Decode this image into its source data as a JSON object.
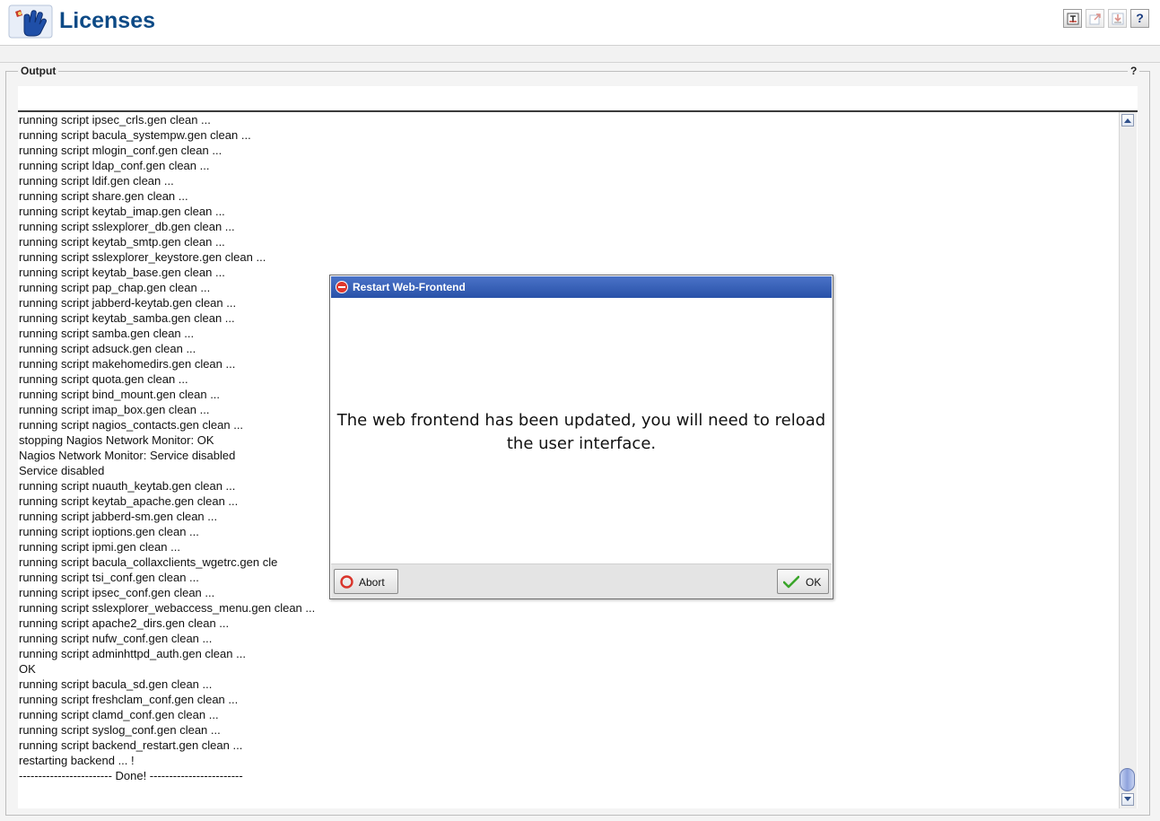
{
  "page": {
    "title": "Licenses"
  },
  "toolbar": {
    "buttons": [
      "export-icon",
      "popout-icon",
      "save-icon",
      "help-icon"
    ],
    "help_label": "?"
  },
  "output": {
    "legend": "Output",
    "help": "?",
    "lines": [
      "running script ipsec_crls.gen clean ...",
      "running script bacula_systempw.gen clean ...",
      "running script mlogin_conf.gen clean ...",
      "running script ldap_conf.gen clean ...",
      "running script ldif.gen clean ...",
      "running script share.gen clean ...",
      "running script keytab_imap.gen clean ...",
      "running script sslexplorer_db.gen clean ...",
      "running script keytab_smtp.gen clean ...",
      "running script sslexplorer_keystore.gen clean ...",
      "running script keytab_base.gen clean ...",
      "running script pap_chap.gen clean ...",
      "running script jabberd-keytab.gen clean ...",
      "running script keytab_samba.gen clean ...",
      "running script samba.gen clean ...",
      "running script adsuck.gen clean ...",
      "running script makehomedirs.gen clean ...",
      "running script quota.gen clean ...",
      "running script bind_mount.gen clean ...",
      "running script imap_box.gen clean ...",
      "running script nagios_contacts.gen clean ...",
      "stopping Nagios Network Monitor: OK",
      "Nagios Network Monitor: Service disabled",
      "Service disabled",
      "running script nuauth_keytab.gen clean ...",
      "running script keytab_apache.gen clean ...",
      "running script jabberd-sm.gen clean ...",
      "running script ioptions.gen clean ...",
      "running script ipmi.gen clean ...",
      "running script bacula_collaxclients_wgetrc.gen cle",
      "running script tsi_conf.gen clean ...",
      "running script ipsec_conf.gen clean ...",
      "running script sslexplorer_webaccess_menu.gen clean ...",
      "running script apache2_dirs.gen clean ...",
      "running script nufw_conf.gen clean ...",
      "running script adminhttpd_auth.gen clean ...",
      "OK",
      "running script bacula_sd.gen clean ...",
      "running script freshclam_conf.gen clean ...",
      "running script clamd_conf.gen clean ...",
      "running script syslog_conf.gen clean ...",
      "running script backend_restart.gen clean ...",
      "restarting backend ... !",
      "------------------------ Done! ------------------------"
    ]
  },
  "dialog": {
    "title": "Restart Web-Frontend",
    "message": "The web frontend has been updated, you will need to reload the user interface.",
    "abort_label": "Abort",
    "ok_label": "OK"
  },
  "colors": {
    "title_blue": "#0d4a86",
    "dialog_titlebar": "#2851a8",
    "abort_red": "#d9342b",
    "ok_green": "#3aa52a"
  }
}
